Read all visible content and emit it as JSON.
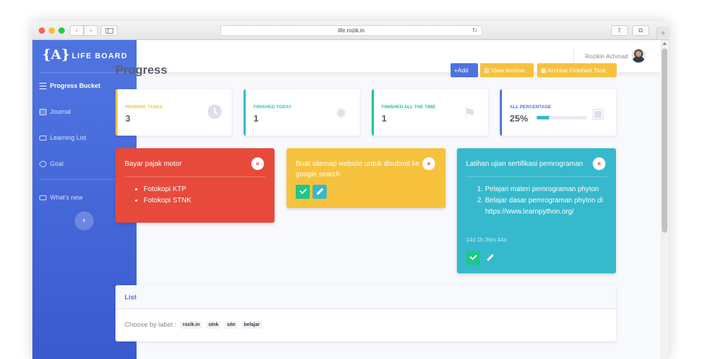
{
  "browser": {
    "url": "life.rozik.in",
    "new_tab_symbol": "+"
  },
  "sidebar": {
    "logo": "{A}",
    "brand": "LIFE BOARD",
    "items": [
      {
        "label": "Progress Bucket"
      },
      {
        "label": "Journal"
      },
      {
        "label": "Learning List"
      },
      {
        "label": "Goal"
      },
      {
        "label": "What's new"
      }
    ],
    "collapse_symbol": "‹"
  },
  "topbar": {
    "user_name": "Rozikin Achmad"
  },
  "main": {
    "title": "Progress",
    "buttons": {
      "add": "+Add",
      "view_archive": "View Archive",
      "archive_finished": "Archive Finished Task"
    },
    "stats": [
      {
        "label": "PENDING TASKS",
        "value": "3"
      },
      {
        "label": "FINISHED TODAY",
        "value": "1"
      },
      {
        "label": "FINISHED ALL THE TIME",
        "value": "1"
      },
      {
        "label": "ALL PERCENTAGE",
        "value": "25%",
        "progress_percent": 25
      }
    ],
    "tasks": [
      {
        "title": "Bayar pajak motor",
        "color": "#e74a3b",
        "items": [
          "Fotokopi KTP",
          "Fotokopi STNK"
        ]
      },
      {
        "title": "Buat sitemap website untuk disubmit ke google search",
        "color": "#f6c23e"
      },
      {
        "title": "Latihan ujian sertifikasi pemrograman",
        "color": "#36b9cc",
        "items": [
          "Pelajari materi pemrograman phyton",
          "Belajar dasar pemrograman phyton di https://www.learnpython.org/"
        ],
        "timer": "14d 1h 36m 44s"
      }
    ],
    "close_symbol": "×",
    "list": {
      "title": "List",
      "choose_label": "Choose by label :",
      "tags": [
        "rozik.in",
        "stnk",
        "site",
        "belajar"
      ]
    }
  },
  "colors": {
    "primary": "#4e73df",
    "warning": "#f6c23e",
    "info": "#36b9cc",
    "success": "#1cc88a",
    "danger": "#e74a3b"
  }
}
